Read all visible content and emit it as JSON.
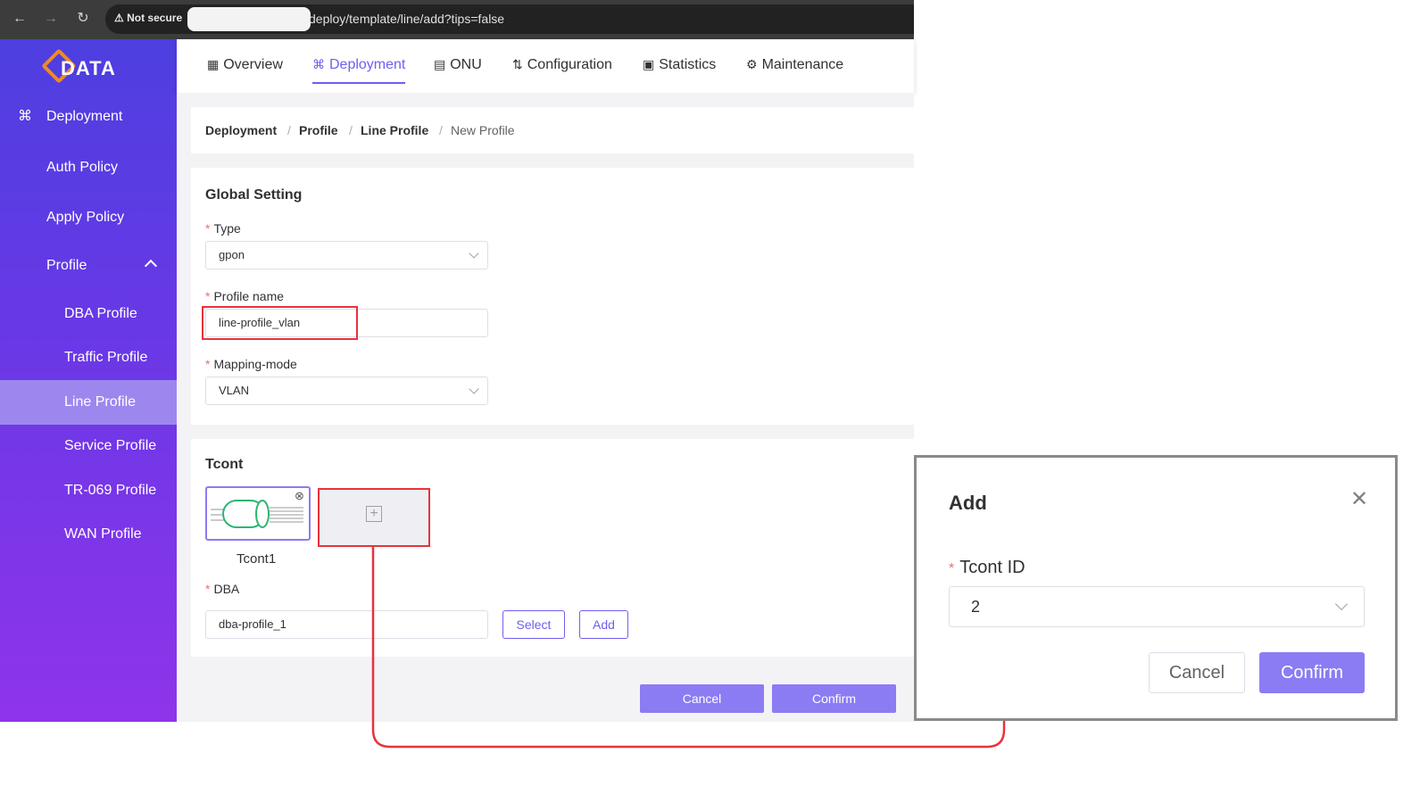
{
  "browser": {
    "not_secure": "Not secure",
    "url": "deploy/template/line/add?tips=false"
  },
  "brand": {
    "logo_text": "DATA"
  },
  "sidebar": {
    "items": [
      {
        "label": "Deployment",
        "icon": "deployment-icon"
      },
      {
        "label": "Auth Policy"
      },
      {
        "label": "Apply Policy"
      },
      {
        "label": "Profile"
      },
      {
        "label": "DBA Profile"
      },
      {
        "label": "Traffic Profile"
      },
      {
        "label": "Line Profile",
        "active": true
      },
      {
        "label": "Service Profile"
      },
      {
        "label": "TR-069 Profile"
      },
      {
        "label": "WAN Profile"
      }
    ]
  },
  "topnav": {
    "tabs": [
      {
        "label": "Overview",
        "icon": "grid-icon"
      },
      {
        "label": "Deployment",
        "icon": "deployment-icon",
        "active": true
      },
      {
        "label": "ONU",
        "icon": "router-icon"
      },
      {
        "label": "Configuration",
        "icon": "sliders-icon"
      },
      {
        "label": "Statistics",
        "icon": "window-icon"
      },
      {
        "label": "Maintenance",
        "icon": "gear-icon"
      }
    ]
  },
  "breadcrumb": {
    "items": [
      "Deployment",
      "Profile",
      "Line Profile",
      "New Profile"
    ],
    "separator": "/"
  },
  "global_setting": {
    "title": "Global Setting",
    "type_label": "Type",
    "type_value": "gpon",
    "profile_name_label": "Profile name",
    "profile_name_value": "line-profile_vlan",
    "mapping_mode_label": "Mapping-mode",
    "mapping_mode_value": "VLAN"
  },
  "tcont": {
    "title": "Tcont",
    "card_label": "Tcont1",
    "dba_label": "DBA",
    "dba_value": "dba-profile_1",
    "select_label": "Select",
    "add_label": "Add"
  },
  "footer": {
    "cancel_label": "Cancel",
    "confirm_label": "Confirm"
  },
  "dialog": {
    "title": "Add",
    "tcont_id_label": "Tcont ID",
    "tcont_id_value": "2",
    "cancel_label": "Cancel",
    "confirm_label": "Confirm"
  },
  "colors": {
    "accent": "#6e5ff0",
    "button_fill": "#8b7cf3",
    "highlight": "#e8323c",
    "required": "#f56c6c"
  }
}
